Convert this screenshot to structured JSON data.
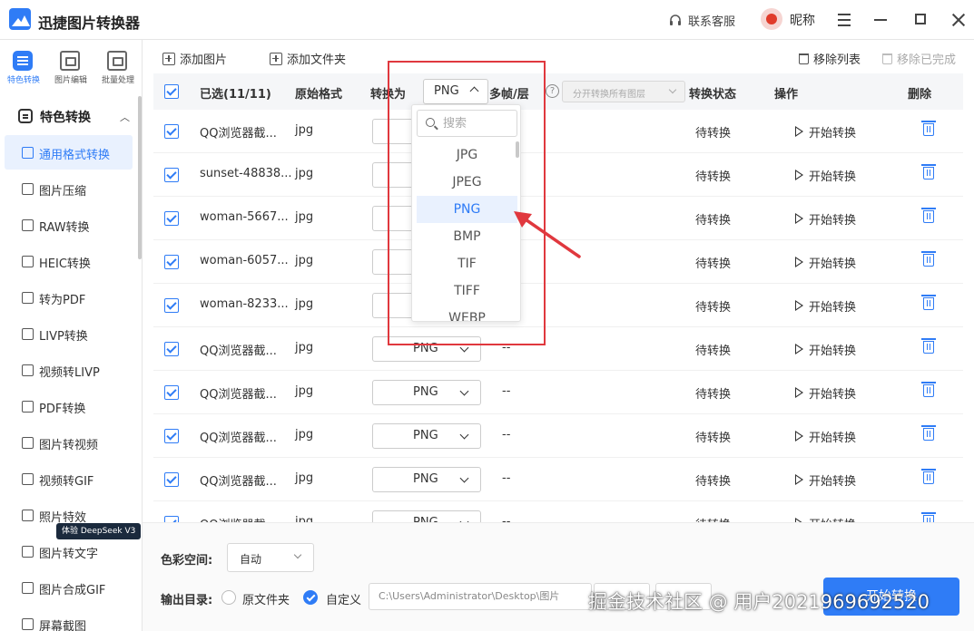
{
  "app": {
    "title": "迅捷图片转换器",
    "support": "联系客服",
    "nickname": "昵称"
  },
  "top_nav": [
    {
      "label": "特色转换",
      "active": true
    },
    {
      "label": "图片编辑",
      "active": false
    },
    {
      "label": "批量处理",
      "active": false
    }
  ],
  "sidebar": {
    "section": "特色转换",
    "items": [
      {
        "label": "通用格式转换",
        "active": true
      },
      {
        "label": "图片压缩"
      },
      {
        "label": "RAW转换"
      },
      {
        "label": "HEIC转换"
      },
      {
        "label": "转为PDF"
      },
      {
        "label": "LIVP转换"
      },
      {
        "label": "视频转LIVP"
      },
      {
        "label": "PDF转换"
      },
      {
        "label": "图片转视频"
      },
      {
        "label": "视频转GIF"
      },
      {
        "label": "照片特效"
      },
      {
        "label": "图片转文字"
      },
      {
        "label": "图片合成GIF"
      },
      {
        "label": "屏幕截图"
      }
    ],
    "badge": "体验 DeepSeek V3"
  },
  "toolbar": {
    "add_image": "添加图片",
    "add_folder": "添加文件夹",
    "remove_list": "移除列表",
    "remove_done": "移除已完成"
  },
  "table": {
    "headers": {
      "selected": "已选(11/11)",
      "original_format": "原始格式",
      "convert_to": "转换为",
      "frames": "多帧/层",
      "help": "?",
      "frames_placeholder": "分开转换所有图层",
      "status": "转换状态",
      "action": "操作",
      "delete": "删除"
    },
    "head_format": "PNG",
    "rows": [
      {
        "name": "QQ浏览器截...",
        "format": "jpg",
        "target": "",
        "frames": "",
        "status": "待转换",
        "action": "开始转换"
      },
      {
        "name": "sunset-48838...",
        "format": "jpg",
        "target": "",
        "frames": "",
        "status": "待转换",
        "action": "开始转换"
      },
      {
        "name": "woman-5667...",
        "format": "jpg",
        "target": "",
        "frames": "",
        "status": "待转换",
        "action": "开始转换"
      },
      {
        "name": "woman-6057...",
        "format": "jpg",
        "target": "",
        "frames": "",
        "status": "待转换",
        "action": "开始转换"
      },
      {
        "name": "woman-8233...",
        "format": "jpg",
        "target": "",
        "frames": "",
        "status": "待转换",
        "action": "开始转换"
      },
      {
        "name": "QQ浏览器截...",
        "format": "jpg",
        "target": "PNG",
        "frames": "--",
        "status": "待转换",
        "action": "开始转换"
      },
      {
        "name": "QQ浏览器截...",
        "format": "jpg",
        "target": "PNG",
        "frames": "--",
        "status": "待转换",
        "action": "开始转换"
      },
      {
        "name": "QQ浏览器截...",
        "format": "jpg",
        "target": "PNG",
        "frames": "--",
        "status": "待转换",
        "action": "开始转换"
      },
      {
        "name": "QQ浏览器截...",
        "format": "jpg",
        "target": "PNG",
        "frames": "--",
        "status": "待转换",
        "action": "开始转换"
      },
      {
        "name": "QQ浏览器截...",
        "format": "jpg",
        "target": "PNG",
        "frames": "--",
        "status": "待转换",
        "action": "开始转换"
      }
    ]
  },
  "dropdown": {
    "search_placeholder": "搜索",
    "options": [
      "JPG",
      "JPEG",
      "PNG",
      "BMP",
      "TIF",
      "TIFF",
      "WEBP"
    ],
    "selected": "PNG"
  },
  "footer": {
    "color_space_label": "色彩空间:",
    "color_space_value": "自动",
    "output_label": "输出目录:",
    "opt_original": "原文件夹",
    "opt_custom": "自定义",
    "custom_selected": true,
    "path": "C:\\Users\\Administrator\\Desktop\\图片",
    "start": "开始转换"
  },
  "watermark": "掘金技术社区 @ 用户2021969692520",
  "colors": {
    "accent": "#2f7cf6",
    "annotation": "#e0383e"
  }
}
